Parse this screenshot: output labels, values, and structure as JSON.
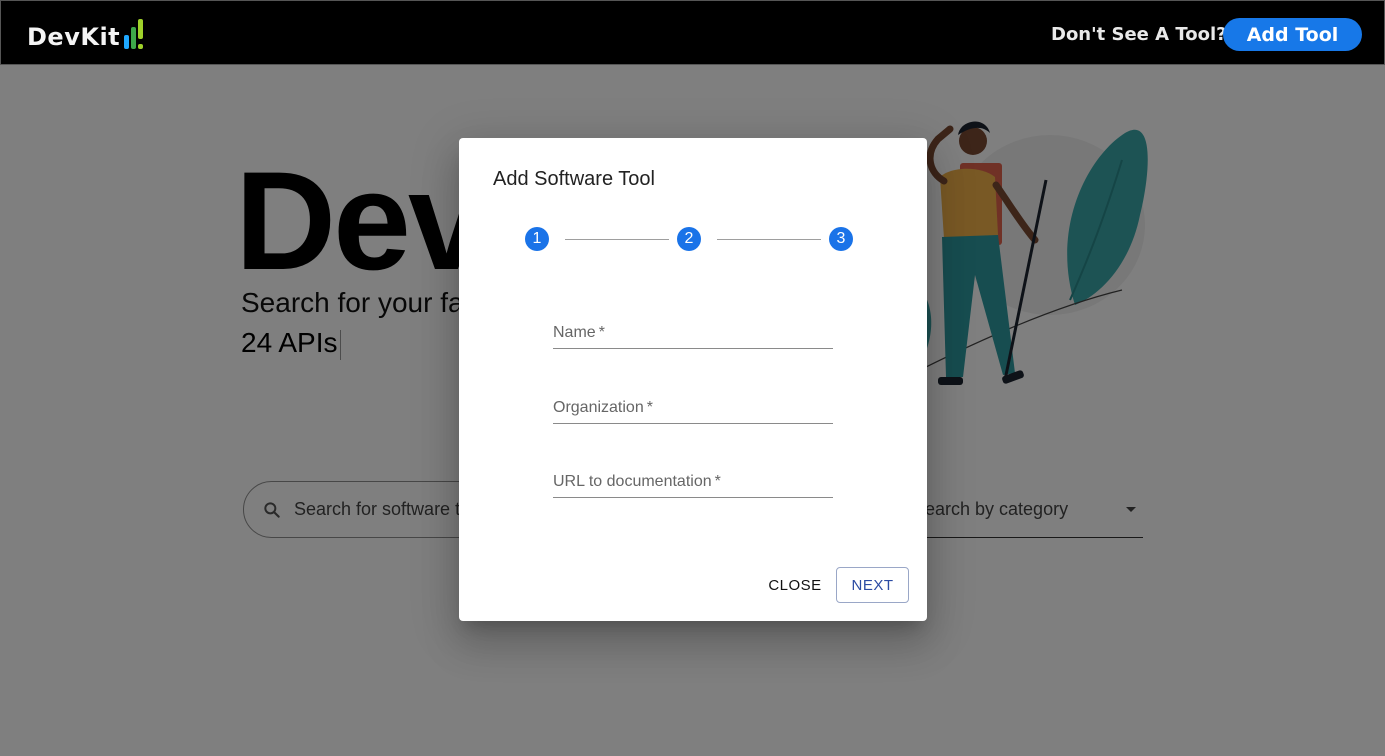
{
  "header": {
    "logo_text": "DevKit",
    "prompt_text": "Don't See A Tool?",
    "add_tool_label": "Add Tool",
    "accent_color": "#1778e8"
  },
  "hero": {
    "title": "Dev",
    "subtitle": "Search for your fav",
    "api_count": "24 APIs"
  },
  "search": {
    "placeholder": "Search for software to",
    "icon": "search-icon"
  },
  "category": {
    "placeholder": "earch by category",
    "icon": "chevron-down-icon"
  },
  "dialog": {
    "title": "Add Software Tool",
    "steps": [
      "1",
      "2",
      "3"
    ],
    "step_color": "#1a73e8",
    "fields": [
      {
        "label": "Name",
        "required": "*",
        "value": ""
      },
      {
        "label": "Organization",
        "required": "*",
        "value": ""
      },
      {
        "label": "URL to documentation",
        "required": "*",
        "value": ""
      }
    ],
    "close_label": "CLOSE",
    "next_label": "NEXT"
  }
}
